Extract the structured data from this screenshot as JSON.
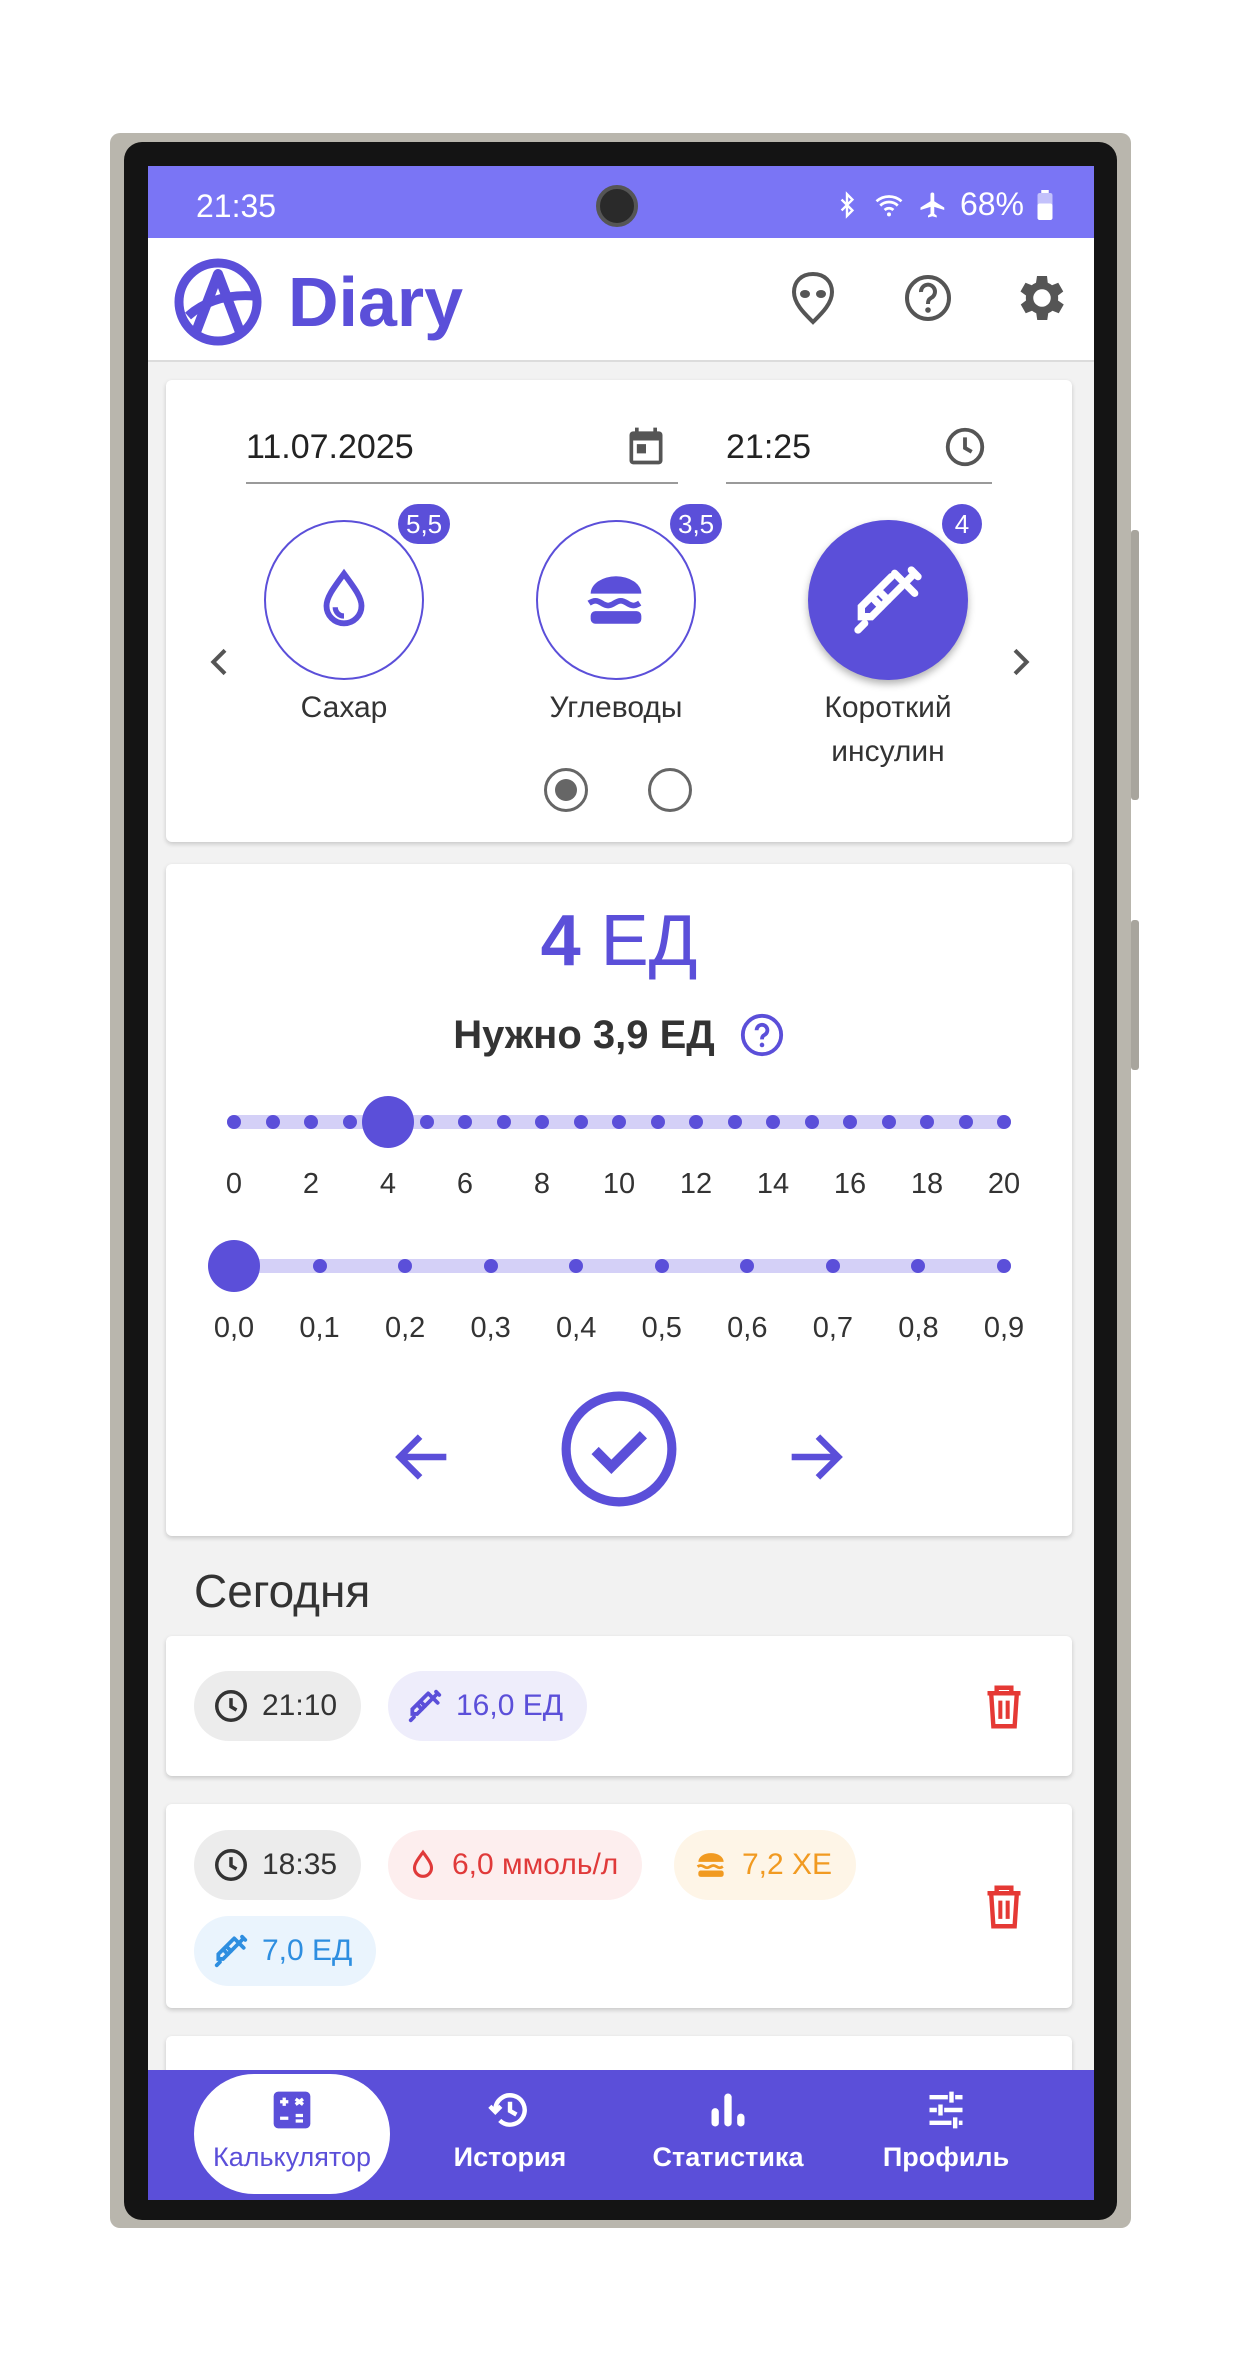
{
  "status_bar": {
    "time": "21:35",
    "battery": "68%"
  },
  "app": {
    "title": "Diary"
  },
  "entry": {
    "date": "11.07.2025",
    "time": "21:25",
    "categories": [
      {
        "label": "Сахар",
        "badge": "5,5",
        "icon": "drop-icon"
      },
      {
        "label": "Углеводы",
        "badge": "3,5",
        "icon": "burger-icon"
      },
      {
        "label_line1": "Короткий",
        "label_line2": "инсулин",
        "badge": "4",
        "icon": "syringe-icon"
      }
    ],
    "page_indicator": {
      "pages": 2,
      "selected": 0
    }
  },
  "dose": {
    "value": "4",
    "unit": "ЕД",
    "need_text": "Нужно 3,9 ЕД",
    "integer_slider": {
      "labels": [
        "0",
        "2",
        "4",
        "6",
        "8",
        "10",
        "12",
        "14",
        "16",
        "18",
        "20"
      ],
      "min": 0,
      "max": 20,
      "value": 4
    },
    "decimal_slider": {
      "labels": [
        "0,0",
        "0,1",
        "0,2",
        "0,3",
        "0,4",
        "0,5",
        "0,6",
        "0,7",
        "0,8",
        "0,9"
      ],
      "min": 0,
      "max": 0.9,
      "value": 0
    }
  },
  "today": {
    "title": "Сегодня",
    "records": [
      {
        "time": "21:10",
        "short_insulin": "16,0 ЕД"
      },
      {
        "time": "18:35",
        "sugar": "6,0 ммоль/л",
        "carbs": "7,2 ХЕ",
        "long_insulin": "7,0 ЕД"
      }
    ]
  },
  "nav": [
    {
      "label": "Калькулятор",
      "icon": "calculator-icon",
      "active": true
    },
    {
      "label": "История",
      "icon": "history-icon",
      "active": false
    },
    {
      "label": "Статистика",
      "icon": "bar-chart-icon",
      "active": false
    },
    {
      "label": "Профиль",
      "icon": "sliders-icon",
      "active": false
    }
  ],
  "colors": {
    "primary": "#5b4fd9",
    "status_bar": "#7a75f5",
    "sugar": "#e03a3a",
    "carbs": "#f19a21",
    "long_insulin": "#2e8ee0",
    "delete": "#e53935"
  }
}
